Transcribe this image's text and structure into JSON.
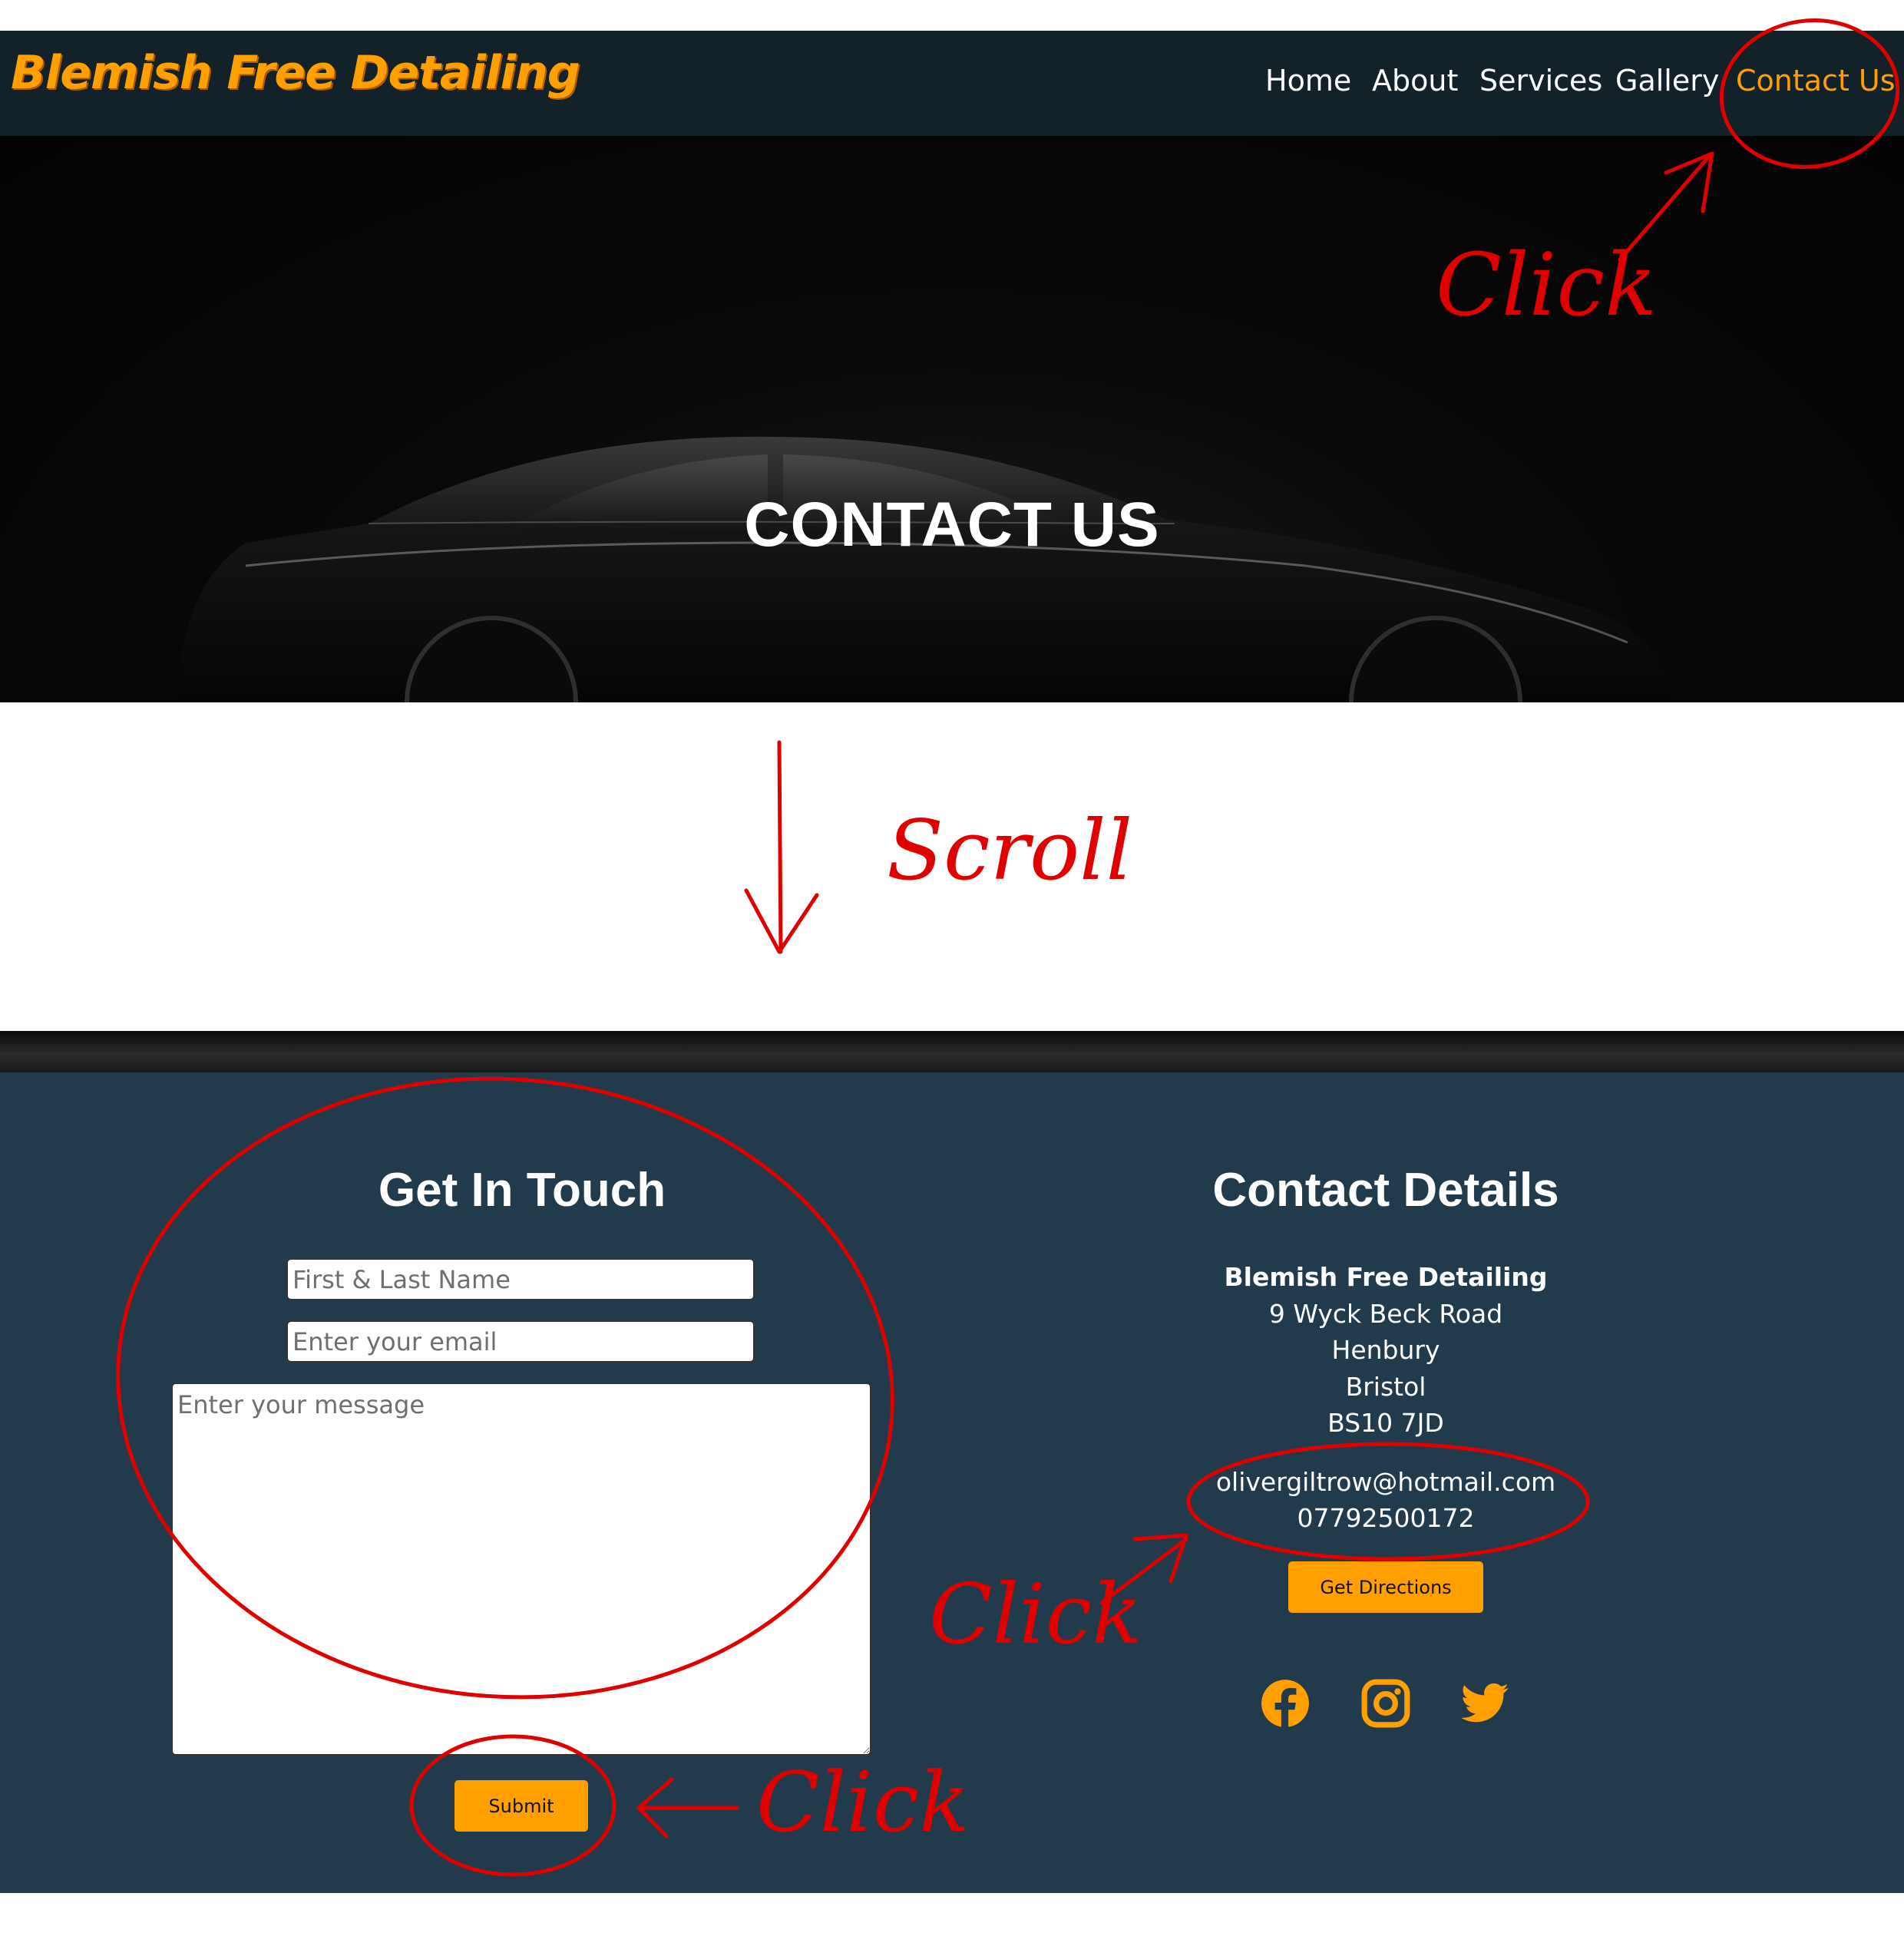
{
  "navbar": {
    "logo": "Blemish Free Detailing",
    "links": [
      "Home",
      "About",
      "Services",
      "Gallery",
      "Contact Us"
    ],
    "active": "Contact Us"
  },
  "hero": {
    "title": "CONTACT US"
  },
  "get_in_touch": {
    "heading": "Get In Touch",
    "name_placeholder": "First & Last Name",
    "email_placeholder": "Enter your email",
    "message_placeholder": "Enter your message",
    "submit_label": "Submit"
  },
  "contact_details": {
    "heading": "Contact Details",
    "address": [
      "Blemish Free Detailing",
      "9 Wyck Beck Road",
      "Henbury",
      "Bristol",
      "BS10 7JD"
    ],
    "email": "olivergiltrow@hotmail.com",
    "phone": "07792500172",
    "directions_label": "Get Directions",
    "social": [
      "facebook-icon",
      "instagram-icon",
      "twitter-icon"
    ]
  },
  "annotations": {
    "click_nav": "Click",
    "scroll": "Scroll",
    "click_contact": "Click",
    "click_submit": "Click"
  },
  "colors": {
    "navbar_bg": "#122228",
    "accent": "#ffa000",
    "section_bg": "#213b4d",
    "annotation_red": "#e00000"
  }
}
